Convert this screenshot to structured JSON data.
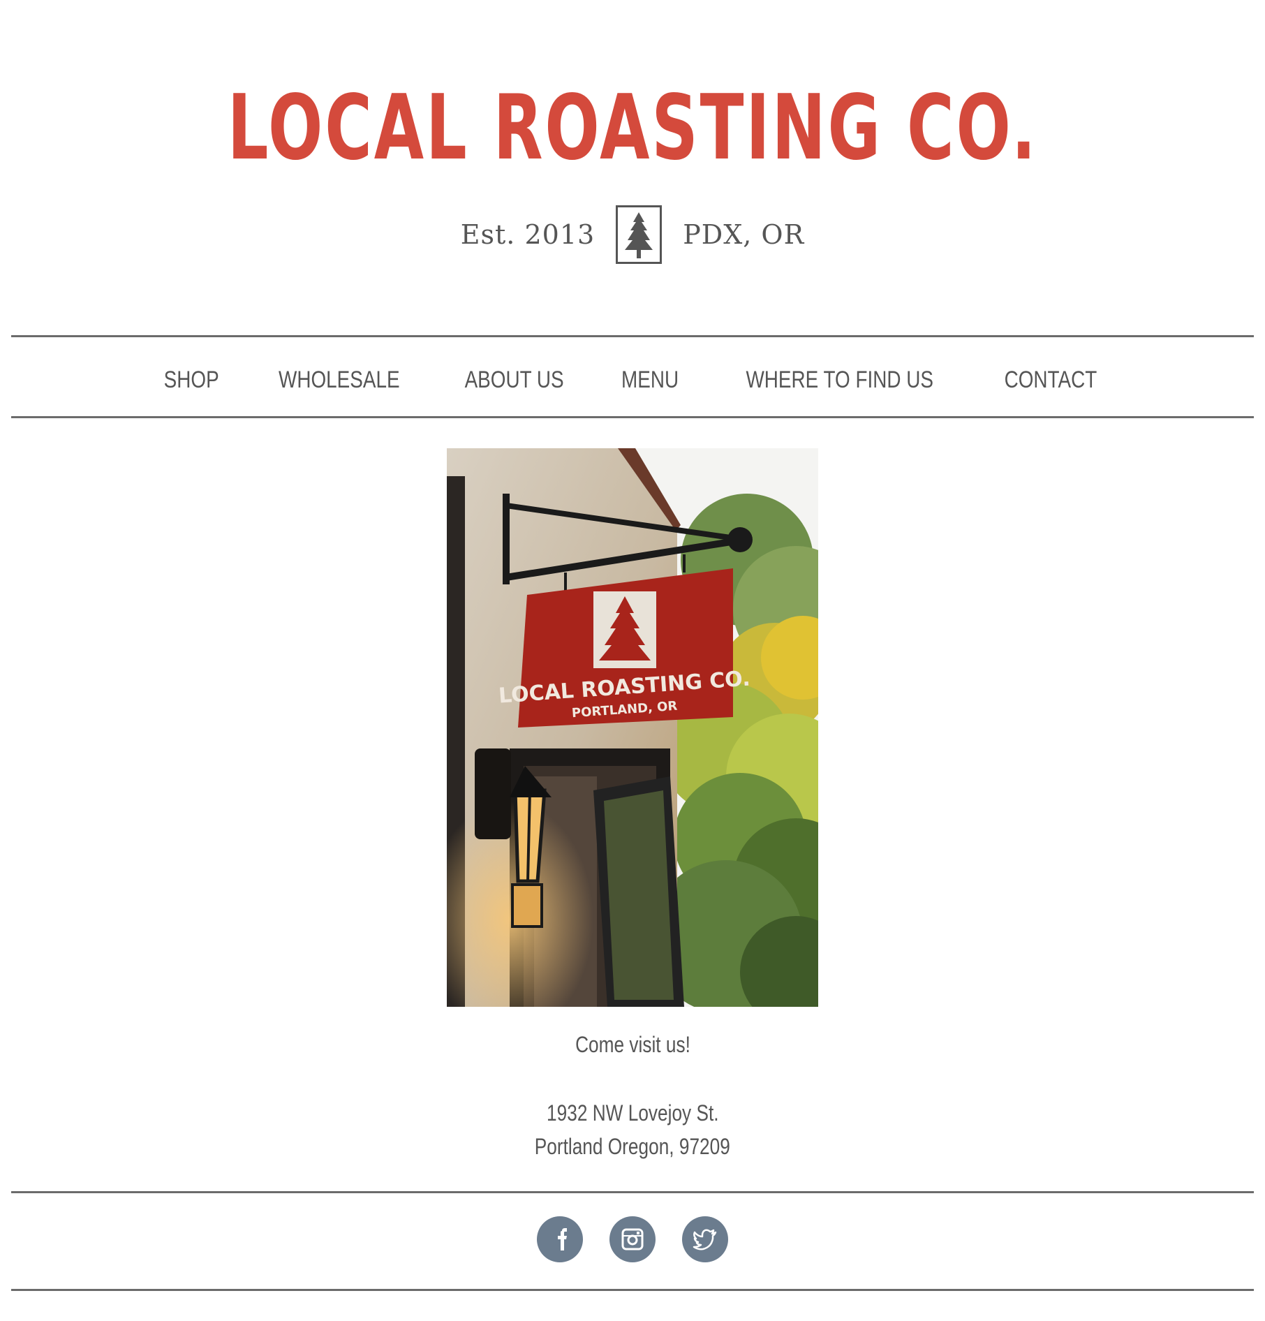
{
  "brand": {
    "title": "LOCAL ROASTING CO.",
    "established": "Est. 2013",
    "location": "PDX, OR",
    "logo_icon": "pine-tree-icon",
    "accent_color": "#d44a3c",
    "text_color": "#555555"
  },
  "nav": {
    "items": [
      {
        "label": "SHOP"
      },
      {
        "label": "WHOLESALE"
      },
      {
        "label": "ABOUT US"
      },
      {
        "label": "MENU"
      },
      {
        "label": "WHERE TO FIND US"
      },
      {
        "label": "CONTACT"
      }
    ]
  },
  "photo": {
    "sign_title": "LOCAL ROASTING CO.",
    "sign_subtitle": "PORTLAND, OR"
  },
  "main": {
    "heading": "Come visit us!",
    "address_line1": "1932 NW Lovejoy St.",
    "address_line2": "Portland Oregon, 97209"
  },
  "social": {
    "icons": [
      "facebook-icon",
      "instagram-icon",
      "twitter-icon"
    ],
    "icon_color": "#6b7c8e"
  }
}
